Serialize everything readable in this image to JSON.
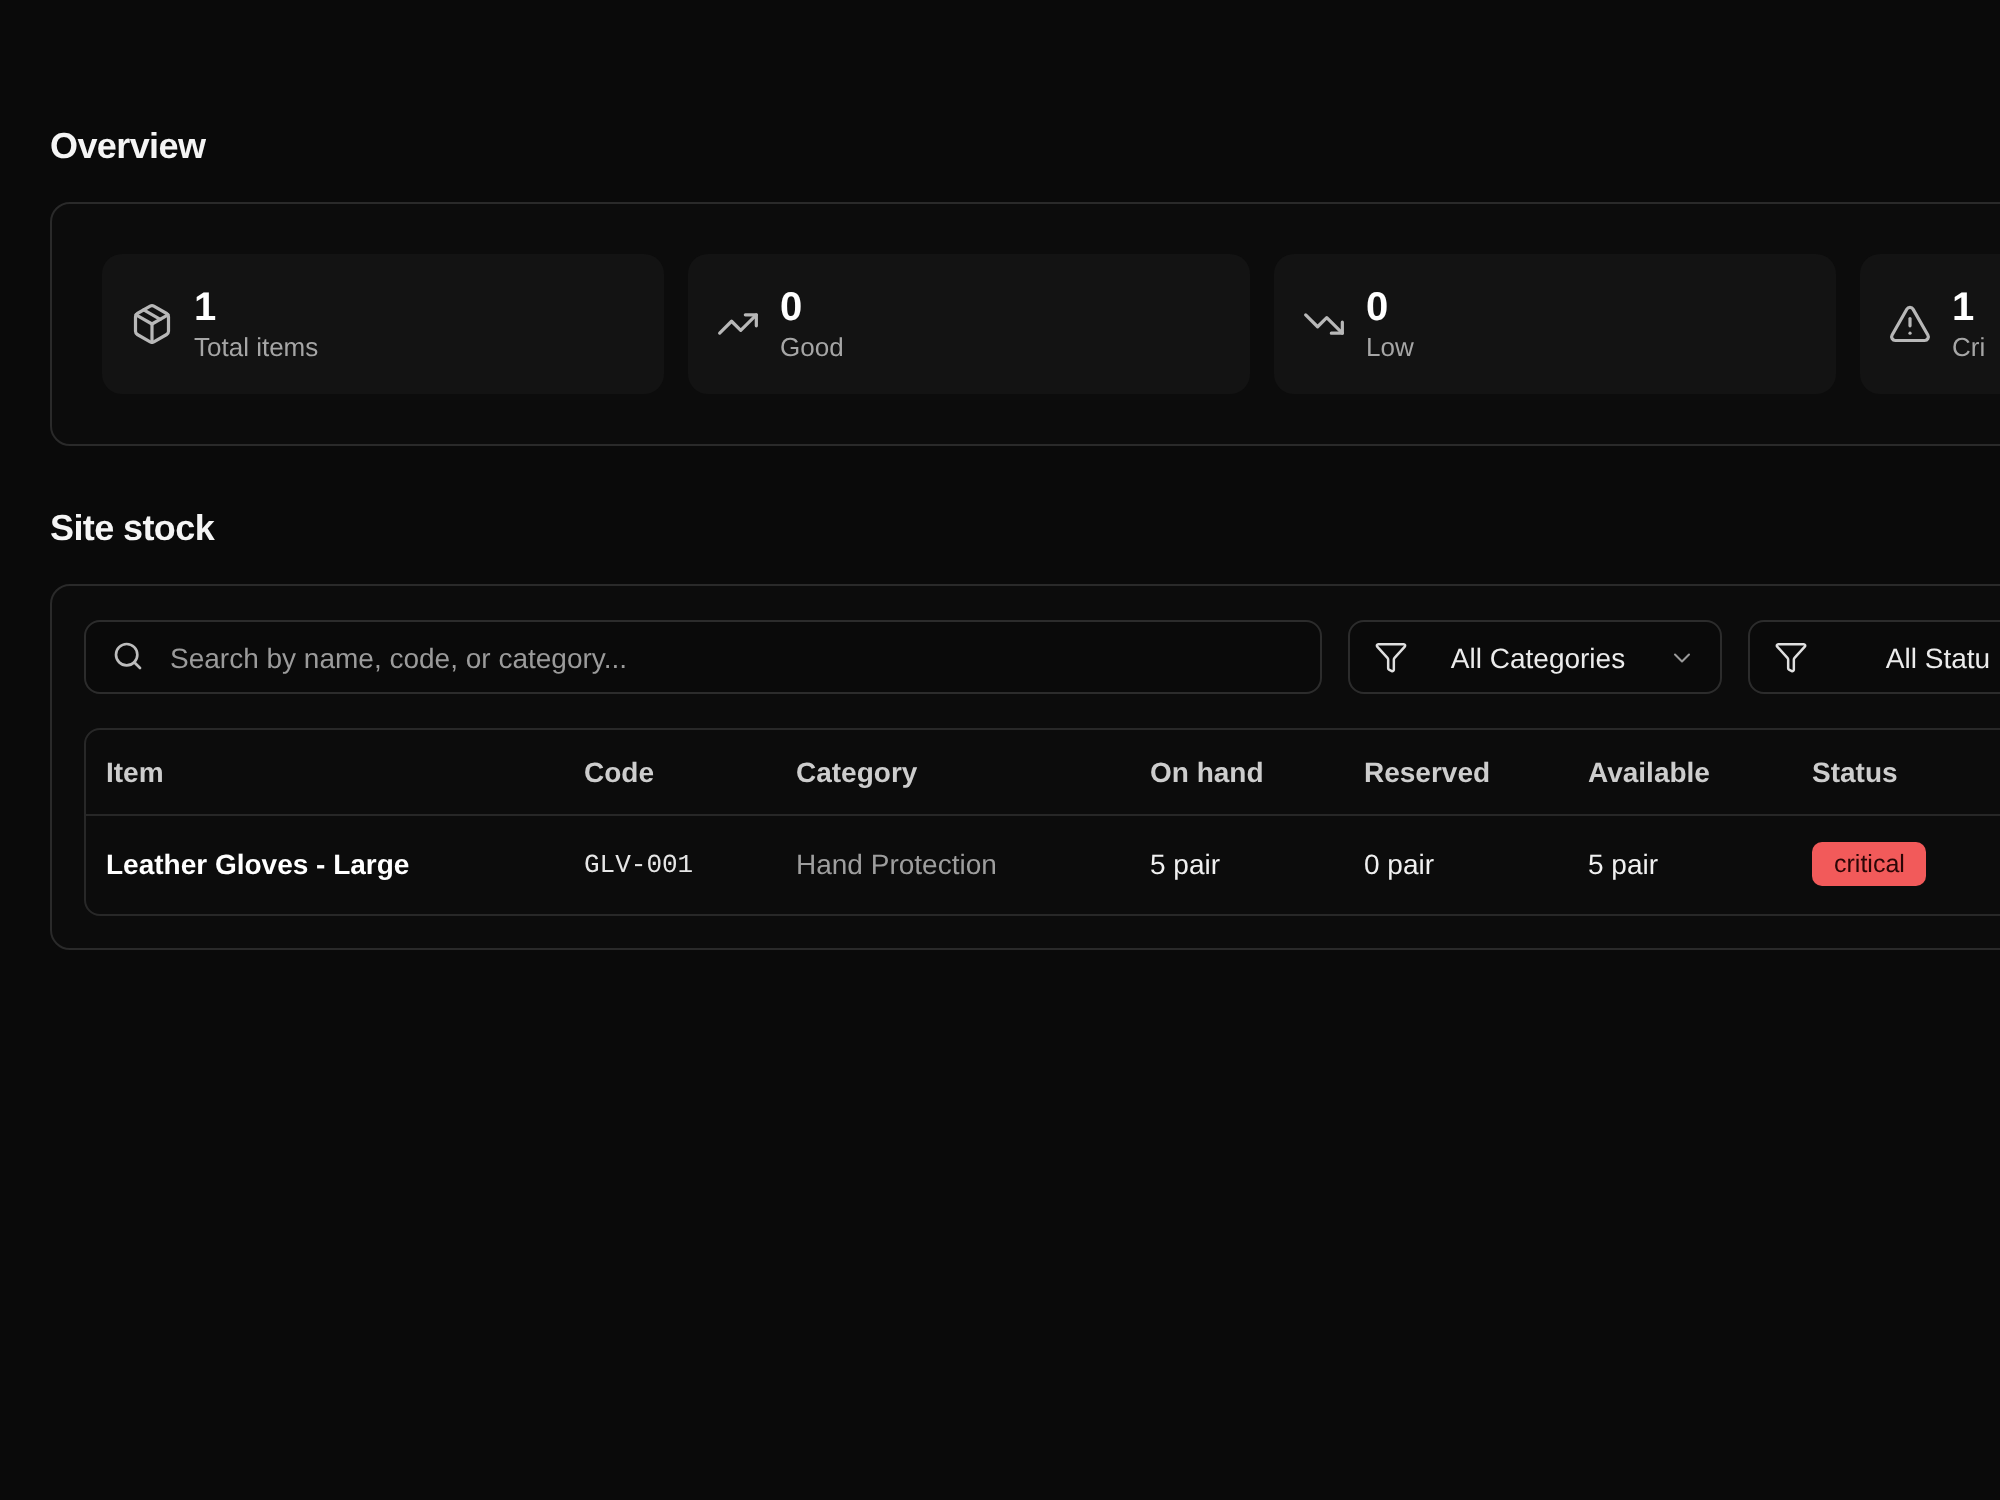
{
  "overview": {
    "title": "Overview",
    "stats": [
      {
        "kind": "total",
        "value": "1",
        "label": "Total items"
      },
      {
        "kind": "good",
        "value": "0",
        "label": "Good"
      },
      {
        "kind": "low",
        "value": "0",
        "label": "Low"
      },
      {
        "kind": "critical",
        "value": "1",
        "label": "Cri"
      }
    ]
  },
  "site_stock": {
    "title": "Site stock",
    "search": {
      "placeholder": "Search by name, code, or category..."
    },
    "filters": [
      {
        "label": "All Categories"
      },
      {
        "label": "All Statu"
      }
    ],
    "table": {
      "columns": [
        "Item",
        "Code",
        "Category",
        "On hand",
        "Reserved",
        "Available",
        "Status"
      ],
      "rows": [
        {
          "item": "Leather Gloves - Large",
          "code": "GLV-001",
          "category": "Hand Protection",
          "on_hand": "5 pair",
          "reserved": "0 pair",
          "available": "5 pair",
          "status": {
            "kind": "critical",
            "label": "critical"
          }
        }
      ]
    }
  }
}
